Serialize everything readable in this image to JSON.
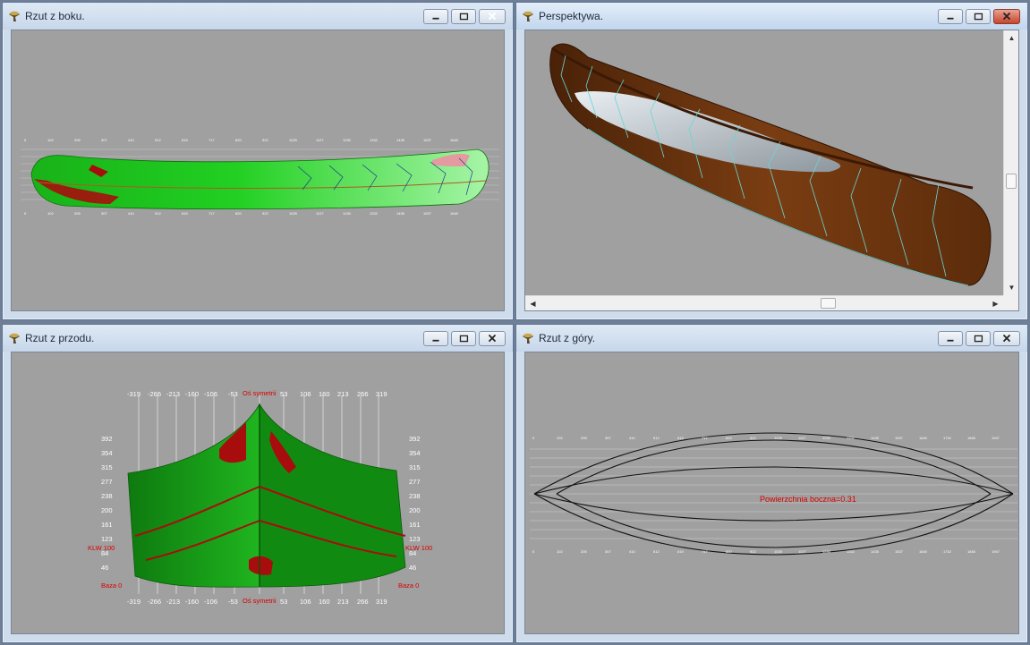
{
  "windows": {
    "side": {
      "title": "Rzut z boku."
    },
    "perspective": {
      "title": "Perspektywa."
    },
    "front": {
      "title": "Rzut z przodu.",
      "x_ticks": [
        "-319",
        "-266",
        "-213",
        "-160",
        "-106",
        "-53",
        "53",
        "106",
        "160",
        "213",
        "266",
        "319"
      ],
      "symmetry_label": "Oś symetrii",
      "y_ticks": [
        "392",
        "354",
        "315",
        "277",
        "238",
        "200",
        "161",
        "123",
        "84",
        "46"
      ],
      "waterline_label": "KLW 100",
      "base_label": "Baza 0"
    },
    "top": {
      "title": "Rzut z góry.",
      "surface_label": "Powierzchnia boczna=0.31"
    }
  },
  "colors": {
    "viewport_bg": "#a0a0a0",
    "hull_green": "#1fbf1f",
    "hull_dark_green": "#0b6f0b",
    "hull_red": "#a80d0d",
    "hull_brown": "#6a3310",
    "label_red": "#d90000"
  }
}
